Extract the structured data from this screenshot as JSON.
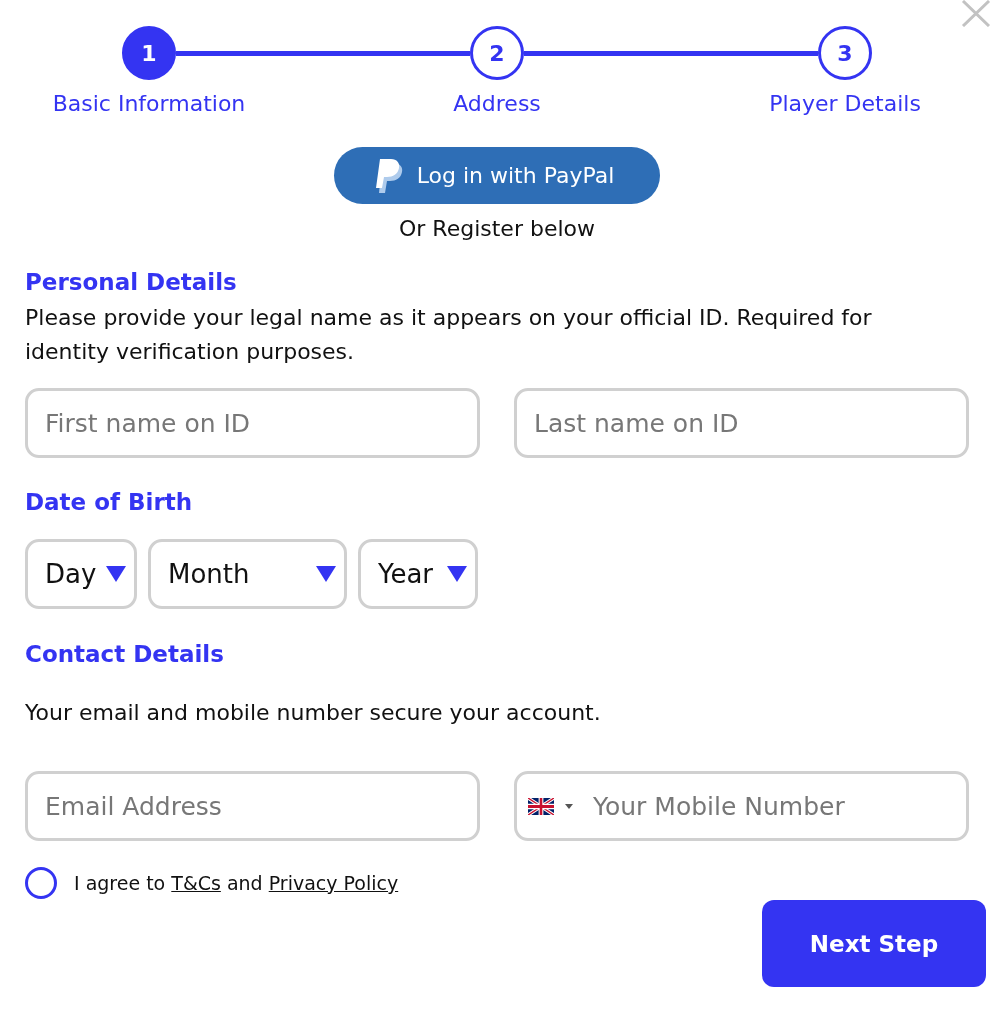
{
  "stepper": {
    "steps": [
      {
        "number": "1",
        "label": "Basic Information",
        "selected": true
      },
      {
        "number": "2",
        "label": "Address",
        "selected": false
      },
      {
        "number": "3",
        "label": "Player Details",
        "selected": false
      }
    ]
  },
  "paypal_button": {
    "label": "Log in with PayPal"
  },
  "register_note": "Or Register below",
  "sections": [
    {
      "kind": "names",
      "heading": "Personal Details",
      "description": "Please provide your legal name as it appears on your official ID. Required for identity verification purposes.",
      "fields": [
        {
          "kind": "text",
          "placeholder": "First name on ID"
        },
        {
          "kind": "text",
          "placeholder": "Last name on ID"
        }
      ]
    },
    {
      "kind": "date",
      "heading": "Date of Birth",
      "fields": [
        {
          "kind": "select",
          "value": "Day"
        },
        {
          "kind": "select",
          "value": "Month"
        },
        {
          "kind": "select",
          "value": "Year"
        }
      ]
    },
    {
      "kind": "contact",
      "heading": "Contact Details",
      "description": "Your email and mobile number secure your account.",
      "fields": [
        {
          "kind": "text",
          "placeholder": "Email Address"
        },
        {
          "kind": "phone",
          "placeholder": "Your Mobile Number"
        }
      ]
    }
  ],
  "agreement": {
    "checked": false,
    "segments": [
      {
        "kind": "text",
        "text": "I agree to"
      },
      {
        "kind": "link",
        "text": "T&Cs"
      },
      {
        "kind": "text",
        "text": "and"
      },
      {
        "kind": "link",
        "text": "Privacy Policy"
      }
    ]
  },
  "next_button": {
    "label": "Next Step"
  }
}
